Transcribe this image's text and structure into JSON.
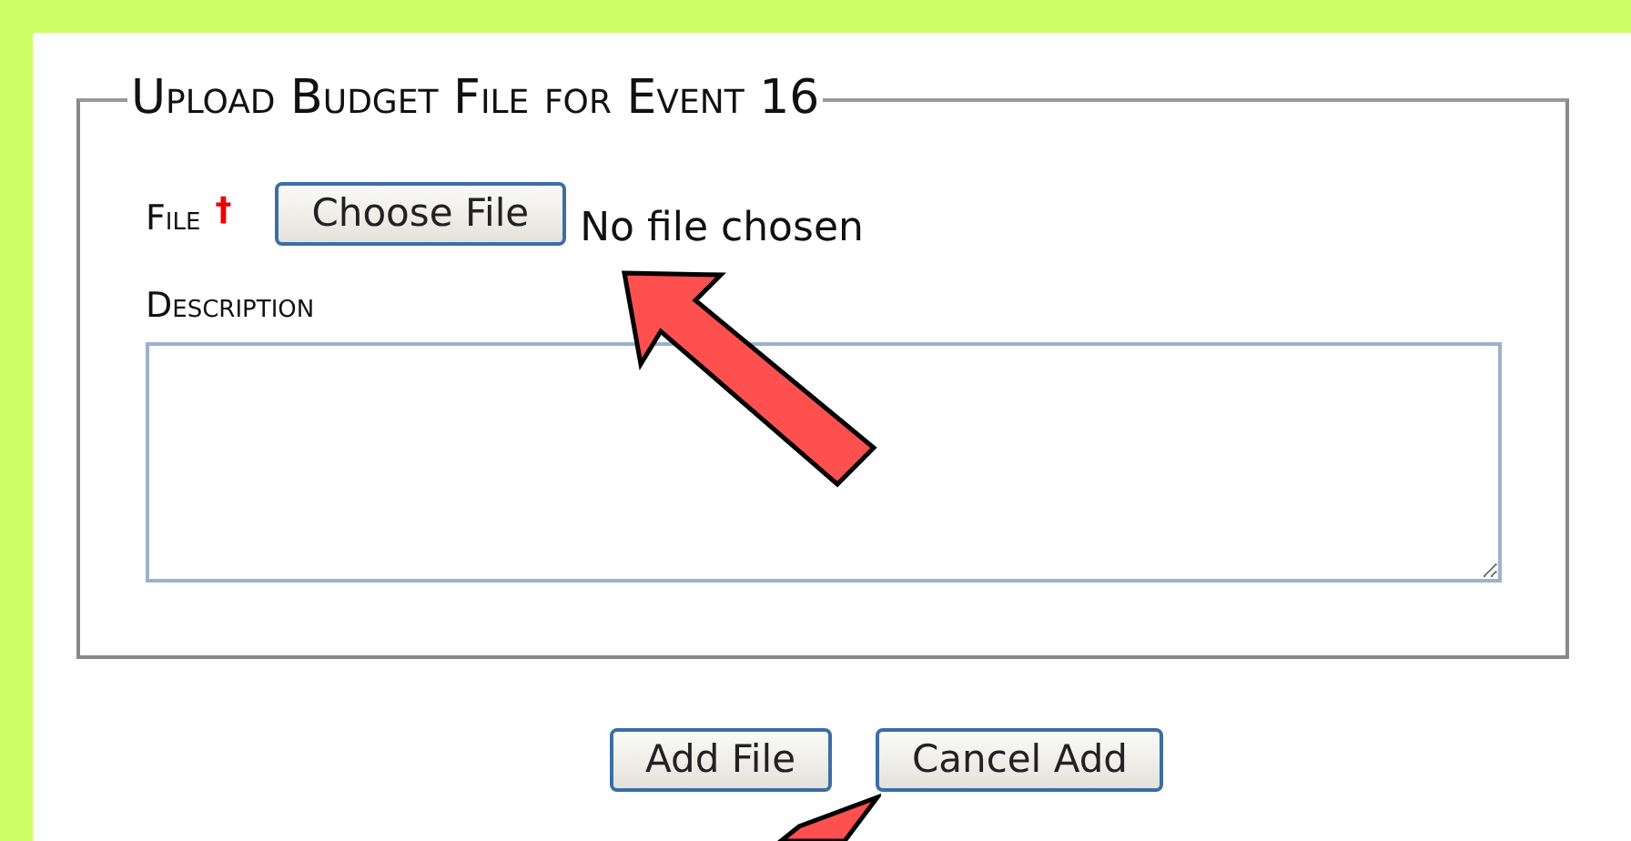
{
  "form": {
    "legend": "Upload Budget File for Event 16",
    "file_field": {
      "label": "File",
      "required_mark": "†",
      "button": "Choose File",
      "status": "No file chosen"
    },
    "description_field": {
      "label": "Description"
    },
    "buttons": [
      "Add File",
      "Cancel Add"
    ]
  }
}
